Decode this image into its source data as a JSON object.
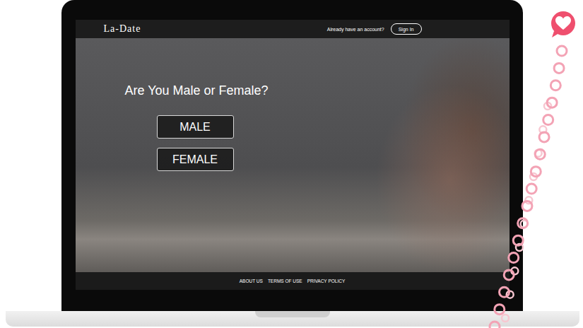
{
  "header": {
    "brand": "La-Date",
    "account_prompt": "Already have an account?",
    "sign_in": "Sign In"
  },
  "hero": {
    "question": "Are You Male or Female?",
    "options": [
      {
        "label": "MALE"
      },
      {
        "label": "FEMALE"
      }
    ]
  },
  "footer": {
    "links": [
      "ABOUT US",
      "TERMS OF USE",
      "PRIVACY POLICY"
    ]
  }
}
